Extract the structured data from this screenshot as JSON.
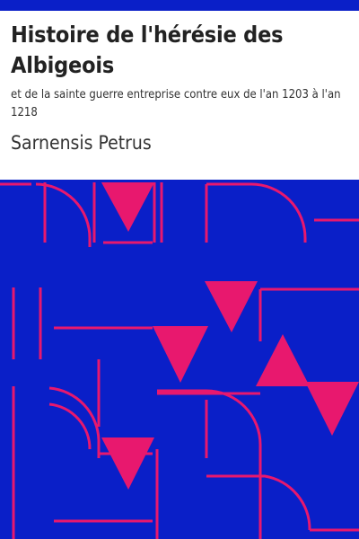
{
  "cover": {
    "title": "Histoire de l'hérésie des Albigeois",
    "subtitle": "et de la sainte guerre entreprise contre eux  de l'an 1203 à  l'an 1218",
    "author": "Sarnensis Petrus"
  },
  "colors": {
    "background": "#ffffff",
    "accent_blue": "#0a1fc8",
    "pattern_magenta": "#e8186e"
  }
}
